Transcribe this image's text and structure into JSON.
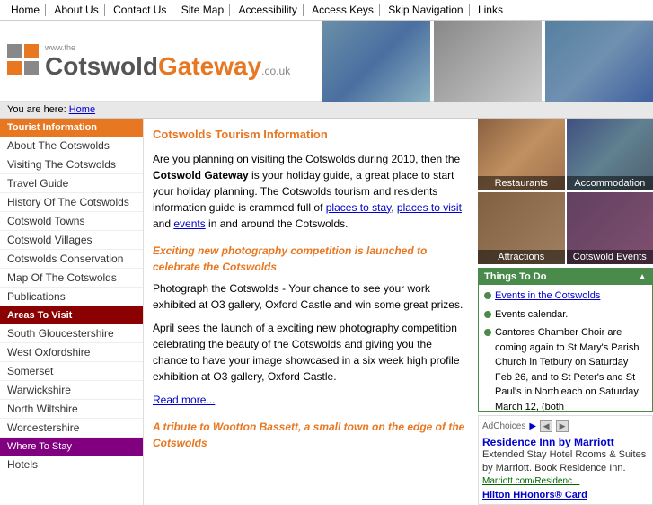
{
  "topnav": {
    "items": [
      "Home",
      "About Us",
      "Contact Us",
      "Site Map",
      "Accessibility",
      "Access Keys",
      "Skip Navigation",
      "Links"
    ]
  },
  "header": {
    "www_the": "www.the",
    "cotswold": "Cotswold",
    "gateway": "Gateway",
    "couk": ".co.uk"
  },
  "breadcrumb": {
    "label": "You are here:",
    "home": "Home"
  },
  "sidebar": {
    "sections": [
      {
        "type": "active-header",
        "label": "Tourist Information"
      },
      {
        "type": "item",
        "label": "About The Cotswolds"
      },
      {
        "type": "item",
        "label": "Visiting The Cotswolds"
      },
      {
        "type": "item",
        "label": "Travel Guide"
      },
      {
        "type": "item",
        "label": "History Of The Cotswolds"
      },
      {
        "type": "item",
        "label": "Cotswold Towns"
      },
      {
        "type": "item",
        "label": "Cotswold Villages"
      },
      {
        "type": "item",
        "label": "Cotswolds Conservation"
      },
      {
        "type": "item",
        "label": "Map Of The Cotswolds"
      },
      {
        "type": "item",
        "label": "Publications"
      },
      {
        "type": "section-header",
        "label": "Areas To Visit"
      },
      {
        "type": "item",
        "label": "South Gloucestershire"
      },
      {
        "type": "item",
        "label": "West Oxfordshire"
      },
      {
        "type": "item",
        "label": "Somerset"
      },
      {
        "type": "item",
        "label": "Warwickshire"
      },
      {
        "type": "item",
        "label": "North Wiltshire"
      },
      {
        "type": "item",
        "label": "Worcestershire"
      },
      {
        "type": "purple-header",
        "label": "Where To Stay"
      },
      {
        "type": "item",
        "label": "Hotels"
      }
    ]
  },
  "main": {
    "title": "Cotswolds Tourism Information",
    "intro": "Are you planning on visiting the Cotswolds during 2010, then the ",
    "brand": "Cotswold Gateway",
    "intro2": " is your holiday guide, a great place to start your holiday planning. The Cotswolds tourism and residents information guide is crammed full of ",
    "link1": "places to stay",
    "link2": "places to visit",
    "link3": "events",
    "intro3": " in and around the Cotswolds.",
    "h2": "Exciting new photography competition is launched to celebrate the Cotswolds",
    "para1": "Photograph the Cotswolds - Your chance to see your work exhibited at O3 gallery, Oxford Castle and win some great prizes.",
    "para2": "April sees the launch of a exciting new photography competition celebrating the beauty of the Cotswolds and giving you the chance to have your image showcased in a six week high profile exhibition at O3 gallery, Oxford Castle.",
    "read_more": "Read more...",
    "h3": "A tribute to Wootton Bassett, a small town on the edge of the Cotswolds"
  },
  "photos": [
    {
      "label": "Restaurants",
      "class": "photo-restaurants"
    },
    {
      "label": "Accommodation",
      "class": "photo-accommodation"
    },
    {
      "label": "Attractions",
      "class": "photo-attractions"
    },
    {
      "label": "Cotswold Events",
      "class": "photo-events"
    }
  ],
  "things_to_do": {
    "header": "Things To Do",
    "scroll_label": "▲▼",
    "items": [
      {
        "link": "Events in the Cotswolds",
        "text": ""
      },
      {
        "text": "Events calendar."
      },
      {
        "text": "Cantores Chamber Choir are coming again to St Mary's Parish Church in Tetbury on Saturday Feb 26, and to St Peter's and St Paul's in Northleach on Saturday March 12, (both"
      }
    ]
  },
  "ads": {
    "header": "AdChoices",
    "nav_prev": "◀",
    "nav_next": "▶",
    "ad1_title": "Residence Inn by Marriott",
    "ad1_body": "Extended Stay Hotel Rooms & Suites by Marriott. Book Residence Inn.",
    "ad1_link": "Marriott.com/Residenc...",
    "ad2_title": "Hilton HHonors® Card"
  }
}
